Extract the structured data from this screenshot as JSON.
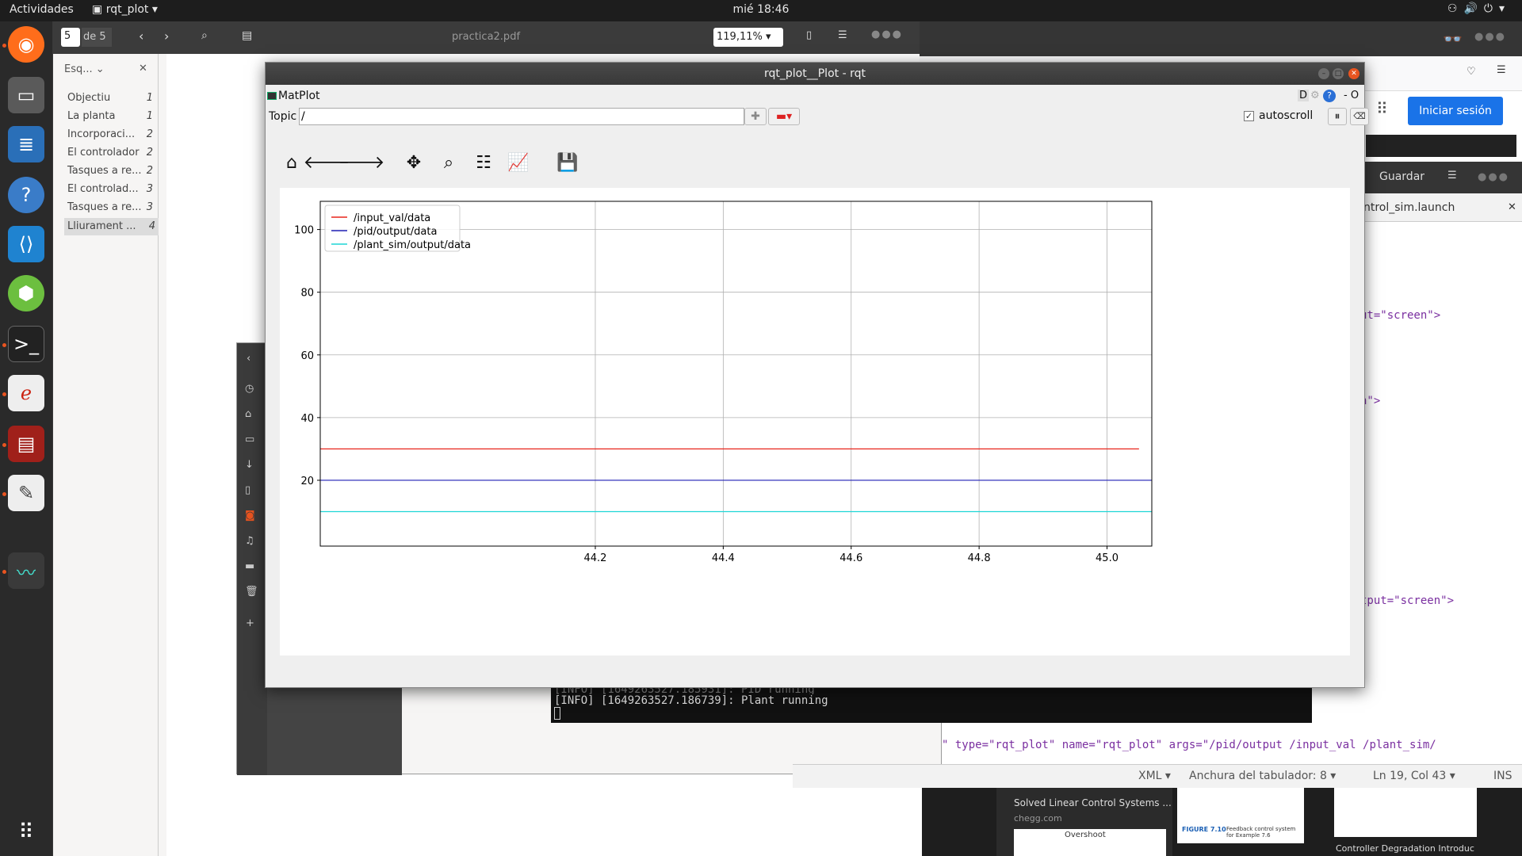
{
  "topbar": {
    "activities": "Actividades",
    "app_menu": "rqt_plot",
    "clock": "mié 18:46"
  },
  "evince": {
    "page_current": "5",
    "page_total": "de 5",
    "filename": "practica2.pdf",
    "zoom": "119,11%",
    "sidebar_label": "Esq...",
    "outline": [
      {
        "label": "Objectiu",
        "page": "1"
      },
      {
        "label": "La planta",
        "page": "1"
      },
      {
        "label": "Incorporaci...",
        "page": "2"
      },
      {
        "label": "El controlador",
        "page": "2"
      },
      {
        "label": "Tasques a re...",
        "page": "2"
      },
      {
        "label": "El controlad...",
        "page": "3"
      },
      {
        "label": "Tasques a re...",
        "page": "3"
      },
      {
        "label": "Lliurament ...",
        "page": "4"
      }
    ]
  },
  "browser": {
    "signin": "Iniciar sesión"
  },
  "gedit": {
    "save": "Guardar",
    "tab_file": "ntrol_sim.launch",
    "code_lines": [
      "ut=\"screen\">",
      "n\">",
      "tput=\"screen\">"
    ],
    "launch_line_pre": "\" type=\"rqt_plot\" name=\"rqt_plot\" args=\"/pid/output /input_val /plant_sim/",
    "status_lang": "XML",
    "status_tab": "Anchura del tabulador: 8",
    "status_pos": "Ln 19, Col 43",
    "status_ins": "INS"
  },
  "search_results": {
    "card_title": "Solved Linear Control Systems ...",
    "card_source": "chegg.com",
    "overshoot": "Overshoot",
    "fig_caption": "FIGURE 7.10",
    "fig_caption_text": "Feedback control system for Example 7.6",
    "degradation": "Controller Degradation Introduc"
  },
  "terminal": {
    "line1": "[INFO] [1649263527.185931]: PID running",
    "line2": "[INFO] [1649263527.186739]: Plant running"
  },
  "rqt": {
    "window_title": "rqt_plot__Plot - rqt",
    "plugin_name": "MatPlot",
    "plugin_controls": "D",
    "plugin_controls2": "- O",
    "topic_label": "Topic",
    "topic_value": "/",
    "autoscroll_label": "autoscroll",
    "autoscroll_checked": true
  },
  "toolbar_icons": [
    "home-icon",
    "back-arrow-icon",
    "forward-arrow-icon",
    "pan-icon",
    "zoom-icon",
    "subplots-config-icon",
    "axes-edit-icon",
    "save-icon"
  ],
  "chart_data": {
    "type": "line",
    "title": "",
    "xlabel": "",
    "ylabel": "",
    "xlim": [
      43.77,
      45.07
    ],
    "ylim": [
      -1,
      109
    ],
    "x_ticks": [
      44.2,
      44.4,
      44.6,
      44.8,
      45.0
    ],
    "x_tick_labels": [
      "44.2",
      "44.4",
      "44.6",
      "44.8",
      "45.0"
    ],
    "y_ticks": [
      20,
      40,
      60,
      80,
      100
    ],
    "y_tick_labels": [
      "20",
      "40",
      "60",
      "80",
      "100"
    ],
    "grid": true,
    "legend_position": "top-left",
    "series": [
      {
        "name": "/input_val/data",
        "color": "#e8251c",
        "x": [
          43.77,
          45.05
        ],
        "values": [
          30,
          30
        ]
      },
      {
        "name": "/pid/output/data",
        "color": "#1f1fb4",
        "x": [
          43.77,
          45.07
        ],
        "values": [
          20,
          20
        ]
      },
      {
        "name": "/plant_sim/output/data",
        "color": "#1fd6d6",
        "x": [
          43.77,
          45.07
        ],
        "values": [
          10,
          10
        ]
      }
    ]
  }
}
